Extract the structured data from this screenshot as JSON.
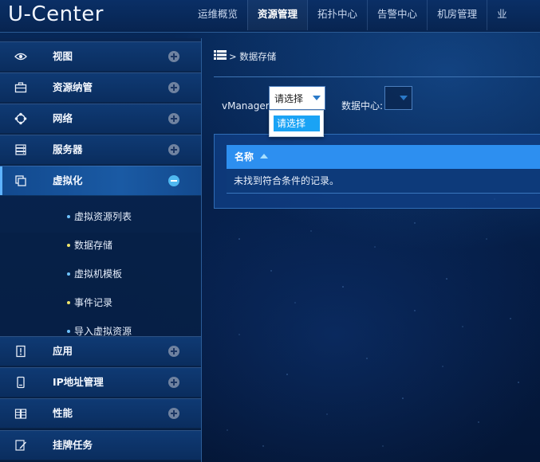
{
  "header": {
    "logo": "U-Center",
    "nav": [
      "运维概览",
      "资源管理",
      "拓扑中心",
      "告警中心",
      "机房管理",
      "业"
    ],
    "active_index": 1
  },
  "sidebar": {
    "items": [
      {
        "label": "视图",
        "icon": "eye-icon",
        "expanded": false
      },
      {
        "label": "资源纳管",
        "icon": "briefcase-icon",
        "expanded": false
      },
      {
        "label": "网络",
        "icon": "network-icon",
        "expanded": false
      },
      {
        "label": "服务器",
        "icon": "server-icon",
        "expanded": false
      },
      {
        "label": "虚拟化",
        "icon": "copy-icon",
        "expanded": true
      },
      {
        "label": "应用",
        "icon": "app-icon",
        "expanded": false
      },
      {
        "label": "IP地址管理",
        "icon": "phone-icon",
        "expanded": false
      },
      {
        "label": "性能",
        "icon": "database-icon",
        "expanded": false
      },
      {
        "label": "挂牌任务",
        "icon": "edit-icon",
        "expanded": false
      }
    ],
    "submenu": [
      {
        "label": "虚拟资源列表",
        "dot": "blue"
      },
      {
        "label": "数据存储",
        "dot": "yellow"
      },
      {
        "label": "虚拟机模板",
        "dot": "blue"
      },
      {
        "label": "事件记录",
        "dot": "yellow"
      },
      {
        "label": "导入虚拟资源",
        "dot": "blue"
      }
    ]
  },
  "breadcrumb": {
    "separator": ">",
    "current": "数据存储"
  },
  "filters": {
    "vmanager_label": "vManager:",
    "vmanager_value": "请选择",
    "datacenter_label": "数据中心:",
    "datacenter_value": "",
    "dropdown_options": [
      "请选择"
    ]
  },
  "table": {
    "column_name": "名称",
    "empty_message": "未找到符合条件的记录。"
  },
  "colors": {
    "accent": "#2d8ff0",
    "dropdown_highlight": "#1aa3f5",
    "active_toggle": "#4fb8f0",
    "background": "#06204a"
  }
}
